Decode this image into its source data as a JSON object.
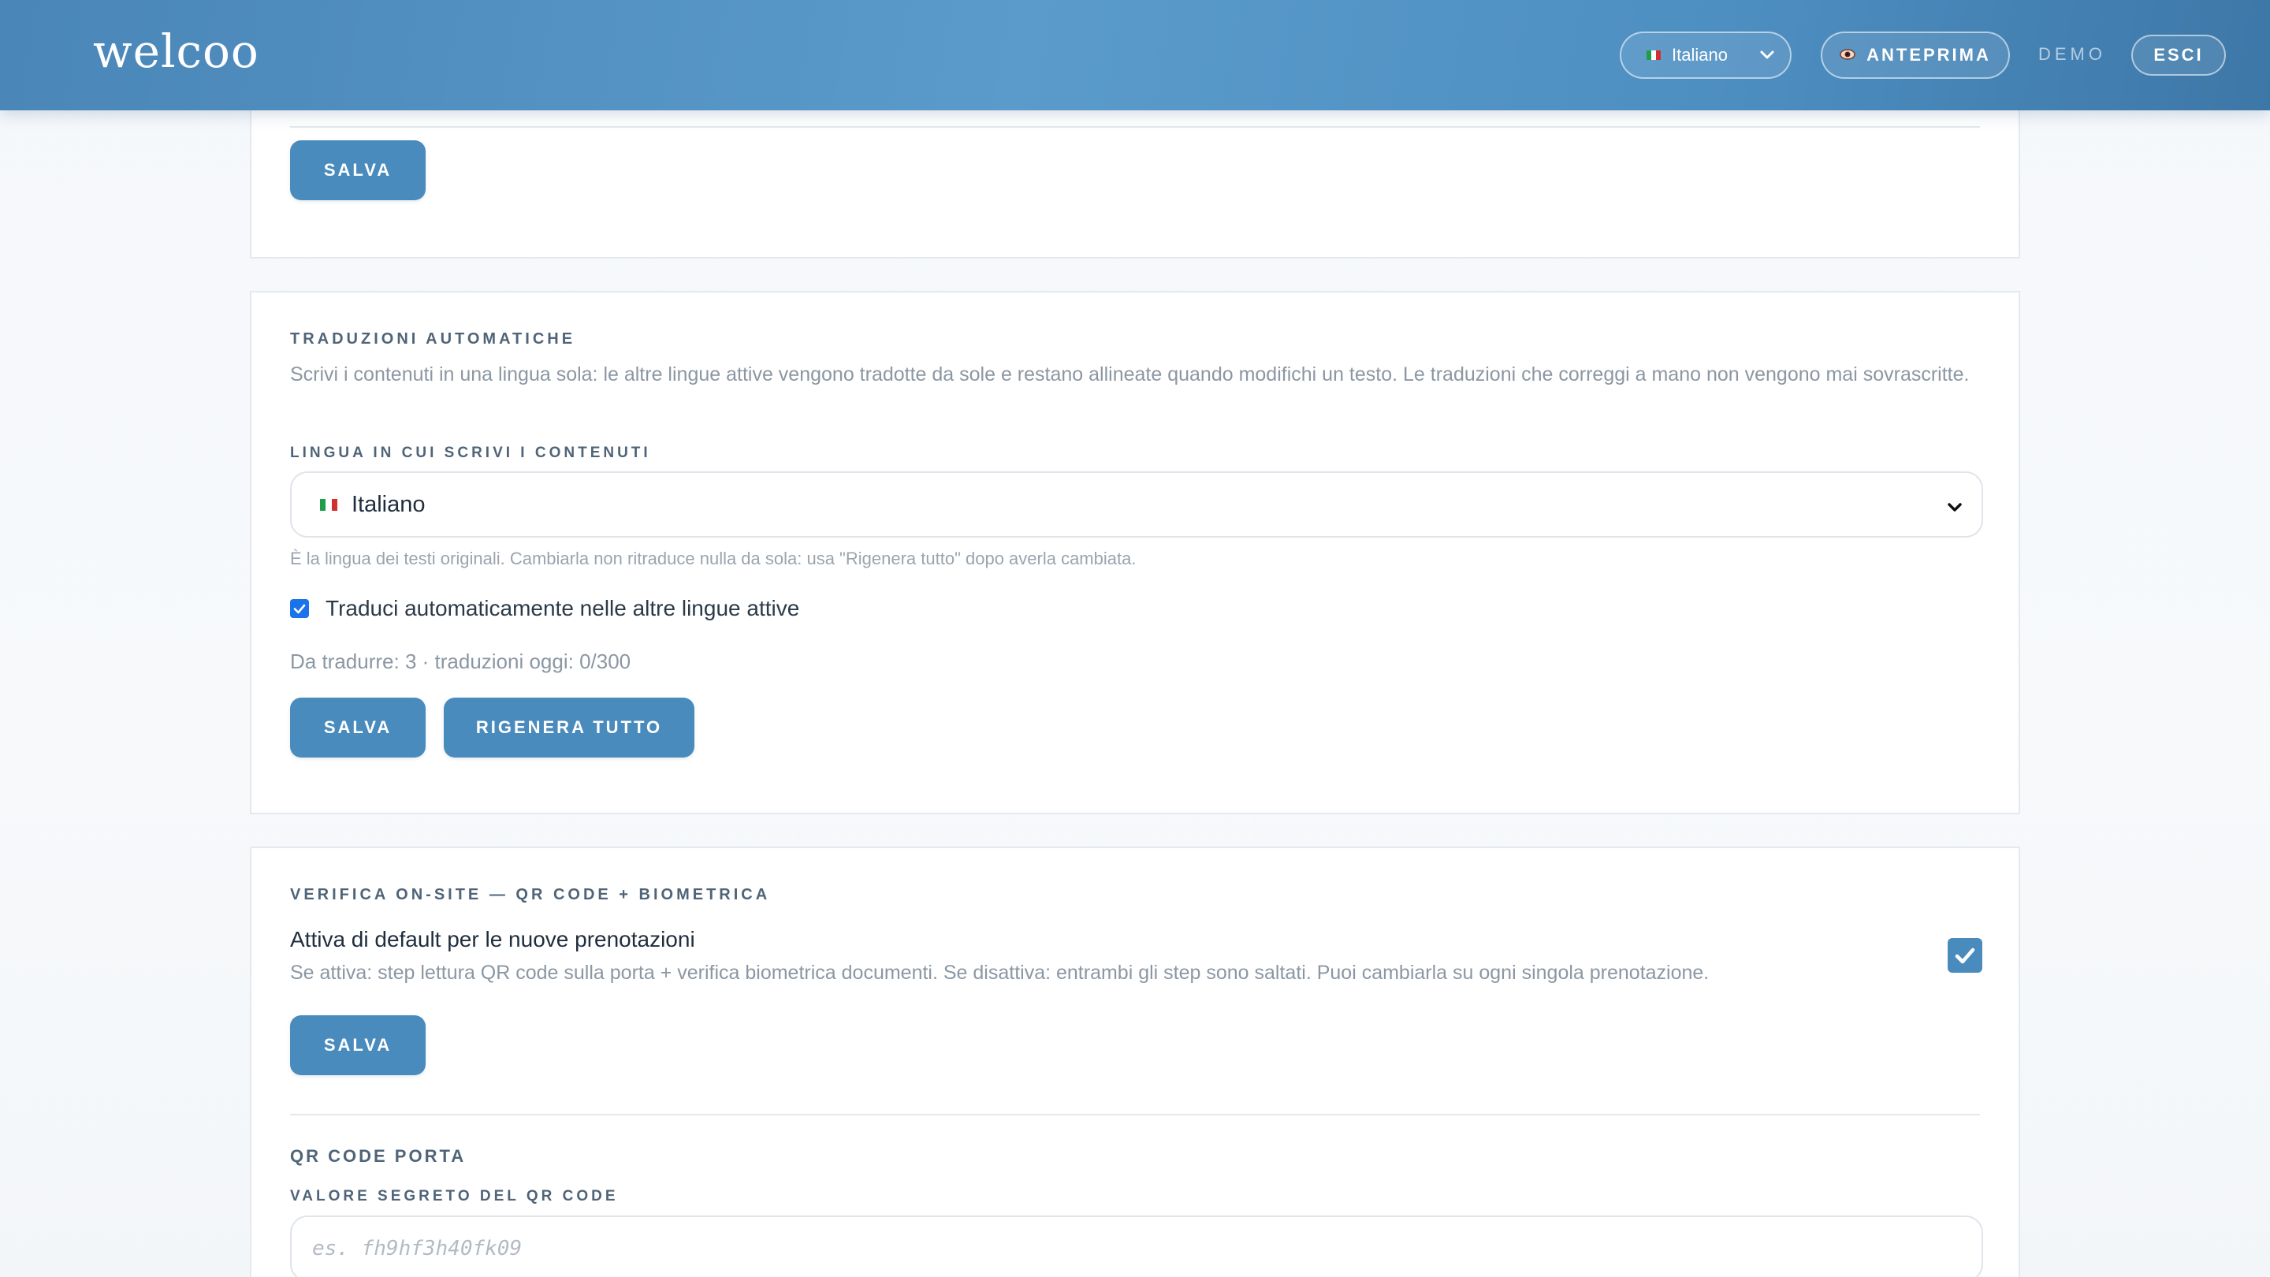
{
  "header": {
    "logo": "welcoo",
    "language_select": {
      "value": "Italiano"
    },
    "preview_label": "ANTEPRIMA",
    "demo_label": "DEMO",
    "logout_label": "ESCI"
  },
  "card_top": {
    "save_label": "SALVA"
  },
  "auto_translations": {
    "title": "TRADUZIONI AUTOMATICHE",
    "description": "Scrivi i contenuti in una lingua sola: le altre lingue attive vengono tradotte da sole e restano allineate quando modifichi un testo. Le traduzioni che correggi a mano non vengono mai sovrascritte.",
    "source_language_label": "LINGUA IN CUI SCRIVI I CONTENUTI",
    "source_language_value": "Italiano",
    "source_language_hint": "È la lingua dei testi originali. Cambiarla non ritraduce nulla da sola: usa \"Rigenera tutto\" dopo averla cambiata.",
    "auto_translate_checkbox": {
      "label": "Traduci automaticamente nelle altre lingue attive",
      "checked": true
    },
    "status_text": "Da tradurre: 3 · traduzioni oggi: 0/300",
    "save_label": "SALVA",
    "regenerate_label": "RIGENERA TUTTO"
  },
  "onsite_verification": {
    "title": "VERIFICA ON-SITE — QR CODE + BIOMETRICA",
    "default_toggle": {
      "label": "Attiva di default per le nuove prenotazioni",
      "description": "Se attiva: step lettura QR code sulla porta + verifica biometrica documenti. Se disattiva: entrambi gli step sono saltati. Puoi cambiarla su ogni singola prenotazione.",
      "checked": true
    },
    "save_label": "SALVA",
    "qr_section_title": "QR CODE PORTA",
    "qr_secret_label": "VALORE SEGRETO DEL QR CODE",
    "qr_secret_placeholder": "es. fh9hf3h40fk09",
    "qr_secret_value": ""
  },
  "colors": {
    "header_gradient_start": "#4a86b8",
    "header_gradient_end": "#3d77a8",
    "primary_button": "#4a8bbd",
    "checkbox_blue": "#1a73e8"
  },
  "icons": {
    "language_flag": "italy-flag-icon",
    "preview": "eye-icon",
    "dropdown": "chevron-down-icon",
    "checkbox": "checkmark-icon"
  }
}
